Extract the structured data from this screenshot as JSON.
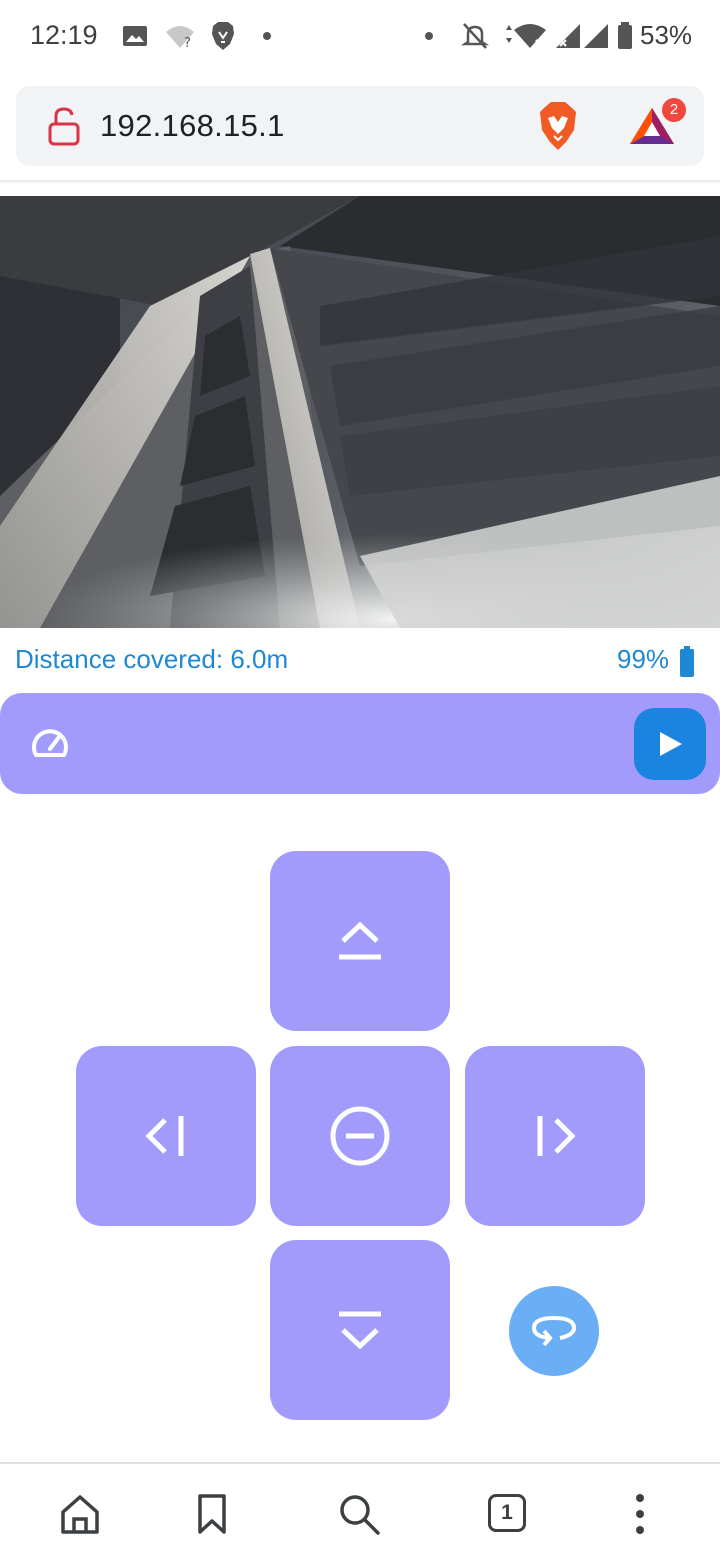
{
  "status_bar": {
    "time": "12:19",
    "battery": "53%"
  },
  "browser": {
    "url": "192.168.15.1",
    "rewards_badge": "2",
    "tab_count": "1"
  },
  "telemetry": {
    "distance": "Distance covered: 6.0m",
    "battery": "99%"
  },
  "controls": {
    "forward_icon": "forward-chevron-icon",
    "left_icon": "left-chevron-icon",
    "stop_icon": "stop-circle-icon",
    "right_icon": "right-chevron-icon",
    "backward_icon": "backward-chevron-icon",
    "rotate_icon": "rotate-icon",
    "speed_icon": "speedometer-icon",
    "play_icon": "play-icon"
  },
  "colors": {
    "pad": "#a29bfc",
    "accent_blue": "#1a84e0",
    "text_blue": "#1e88d4",
    "rotate": "#6aaff5"
  },
  "bottom_nav": [
    "home-icon",
    "bookmark-icon",
    "search-icon",
    "tabs-icon",
    "menu-icon"
  ]
}
